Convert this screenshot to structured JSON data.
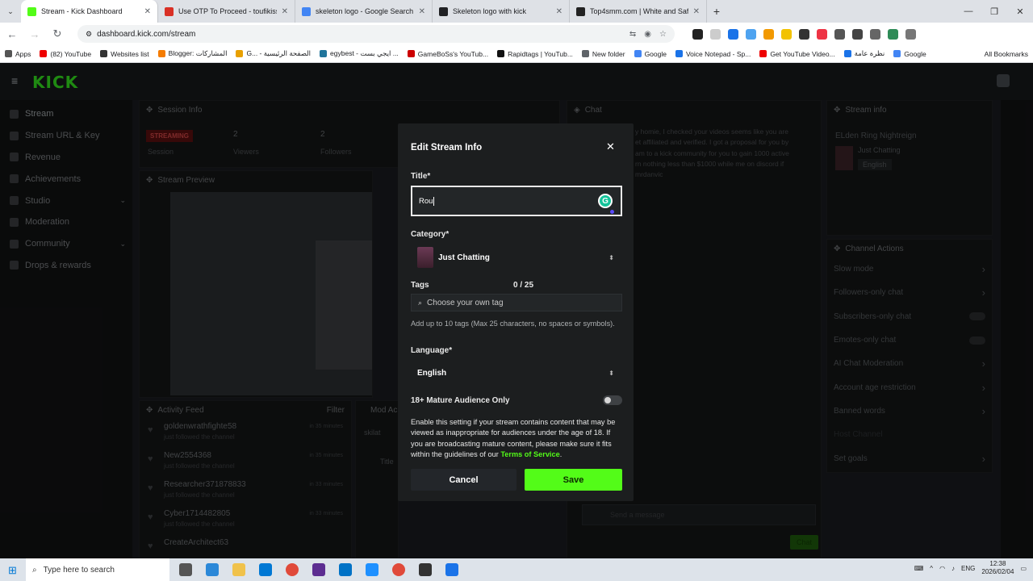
{
  "browser": {
    "tabs": [
      {
        "title": "Stream - Kick Dashboard",
        "color": "#53fc18",
        "active": true
      },
      {
        "title": "Use OTP To Proceed - toufikiss...",
        "color": "#d93025"
      },
      {
        "title": "skeleton logo - Google Search",
        "color": "#4285f4"
      },
      {
        "title": "Skeleton logo with kick",
        "color": "#202124"
      },
      {
        "title": "Top4smm.com | White and Safe...",
        "color": "#222"
      }
    ],
    "url": "dashboard.kick.com/stream",
    "bookmarks": [
      "Apps",
      "(82) YouTube",
      "Websites list",
      "Blogger: المشاركات",
      "G... - الصفحة الرئيسية",
      "egybest - ايجي بست ...",
      "GameBoSs's YouTub...",
      "Rapidtags | YouTub...",
      "New folder",
      "Google",
      "Voice Notepad - Sp...",
      "Get YouTube Video...",
      "نظرة عامة",
      "Google"
    ],
    "all_bookmarks": "All Bookmarks"
  },
  "sidebar": {
    "items": [
      {
        "label": "Stream",
        "icon": "broadcast-icon"
      },
      {
        "label": "Stream URL & Key",
        "icon": "key-icon"
      },
      {
        "label": "Revenue",
        "icon": "dollar-icon"
      },
      {
        "label": "Achievements",
        "icon": "trophy-icon"
      },
      {
        "label": "Studio",
        "icon": "studio-icon",
        "chevron": true
      },
      {
        "label": "Moderation",
        "icon": "shield-icon"
      },
      {
        "label": "Community",
        "icon": "people-icon",
        "chevron": true
      },
      {
        "label": "Drops & rewards",
        "icon": "gift-icon"
      }
    ]
  },
  "session": {
    "title": "Session Info",
    "status": "STREAMING",
    "session_label": "Session",
    "viewers": "2",
    "viewers_label": "Viewers",
    "followers": "2",
    "followers_label": "Followers"
  },
  "preview": {
    "title": "Stream Preview"
  },
  "activity": {
    "title": "Activity Feed",
    "filter": "Filter",
    "items": [
      {
        "name": "goldenwrathfighte58",
        "sub": "just followed the channel",
        "time": "in 35 minutes"
      },
      {
        "name": "New2554368",
        "sub": "just followed the channel",
        "time": "in 35 minutes"
      },
      {
        "name": "Researcher371878833",
        "sub": "just followed the channel",
        "time": "in 33 minutes"
      },
      {
        "name": "Cyber1714482805",
        "sub": "just followed the channel",
        "time": "in 33 minutes"
      },
      {
        "name": "CreateArchitect63",
        "sub": "",
        "time": ""
      }
    ]
  },
  "modactions": {
    "title": "Mod Ac",
    "items": [
      "skilat",
      "Title"
    ]
  },
  "chat": {
    "title": "Chat",
    "message": "y homie, I checked your videos seems like you are\net affiliated and verified. I got a proposal for you by\nam to a kick community for you to gain 1000 active\nrn nothing less than $1000 while me on discord if\n  mrdanvic",
    "placeholder": "Send a message",
    "send": "Chat"
  },
  "streaminfo": {
    "title": "Stream info",
    "game": "ELden Ring Nightreign",
    "category": "Just Chatting",
    "language": "English"
  },
  "channel_actions": {
    "title": "Channel Actions",
    "items": [
      "Slow mode",
      "Followers-only chat",
      "Subscribers-only chat",
      "Emotes-only chat",
      "AI Chat Moderation",
      "Account age restriction",
      "Banned words",
      "Host Channel",
      "Set goals"
    ]
  },
  "modal": {
    "heading": "Edit Stream Info",
    "title_label": "Title*",
    "title_value": "Rou",
    "category_label": "Category*",
    "category_value": "Just Chatting",
    "tags_label": "Tags",
    "tags_count": "0 / 25",
    "tags_placeholder": "Choose your own tag",
    "tags_help": "Add up to 10 tags (Max 25 characters, no spaces or symbols).",
    "language_label": "Language*",
    "language_value": "English",
    "mature_label": "18+ Mature Audience Only",
    "mature_on": false,
    "mature_text": "Enable this setting if your stream contains content that may be viewed as inappropriate for audiences under the age of 18. If you are broadcasting mature content, please make sure it fits within the guidelines of our ",
    "tos_link": "Terms of Service",
    "mature_end": ".",
    "cancel": "Cancel",
    "save": "Save",
    "accent": "#53fc18"
  },
  "taskbar": {
    "search_placeholder": "Type here to search",
    "time": "12:38",
    "date": "2026/02/04"
  }
}
